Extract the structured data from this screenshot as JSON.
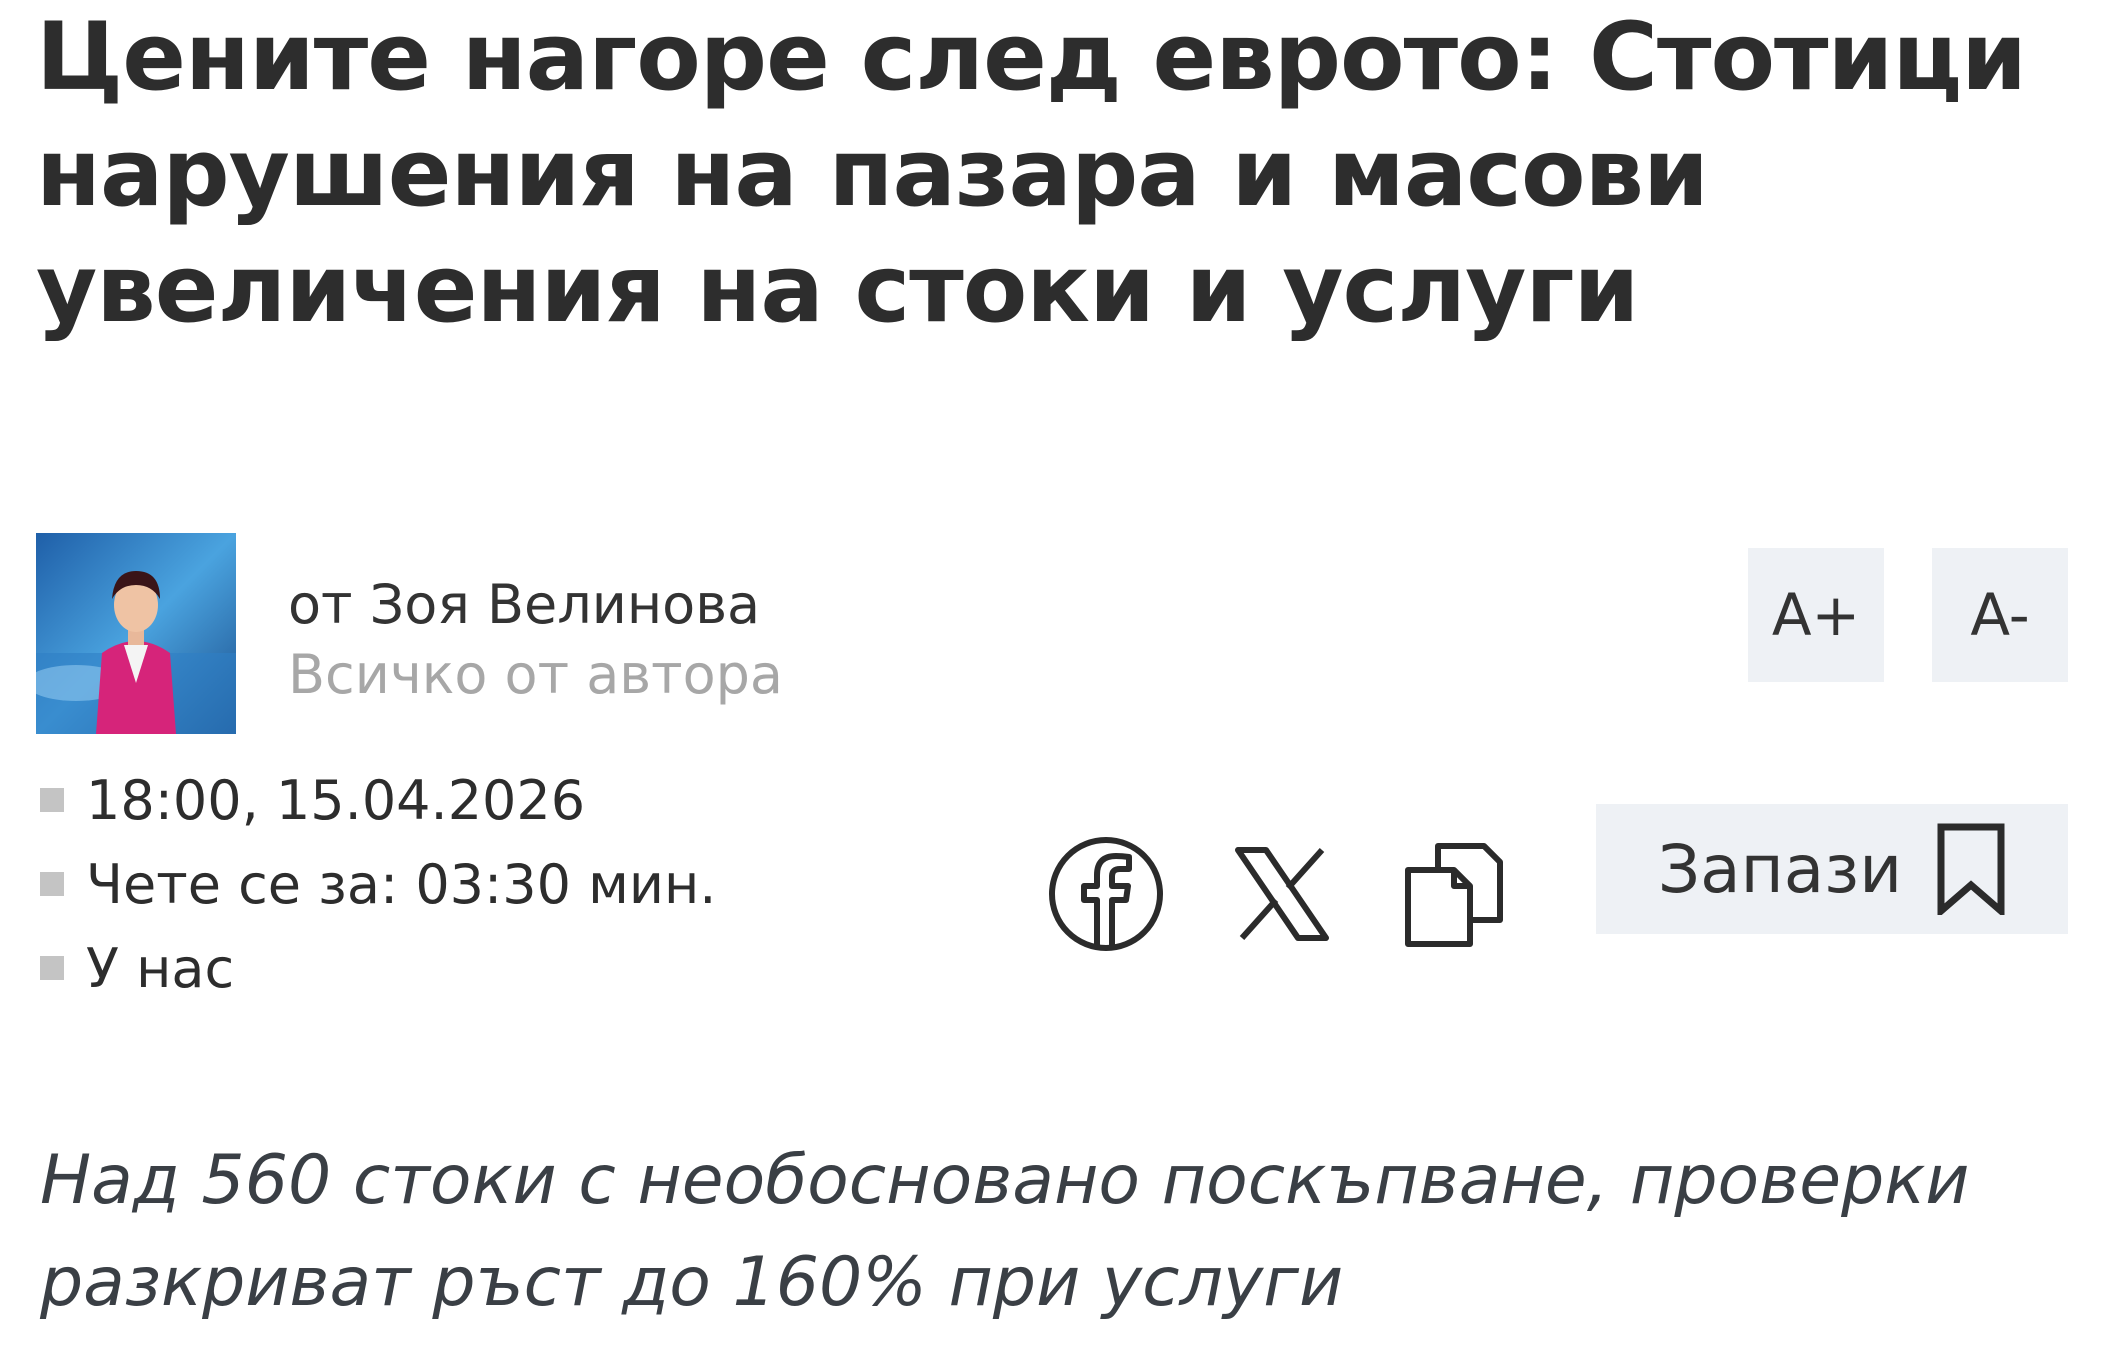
{
  "article": {
    "title": "Цените нагоре след еврото: Стотици нарушения на пазара и масови увеличения на стоки и услуги",
    "lead": "Над 560 стоки с необосновано поскъпване, проверки разкриват ръст до 160% при услуги"
  },
  "author": {
    "byline": "от Зоя Велинова",
    "all_link": "Всичко от автора"
  },
  "font_controls": {
    "increase_label": "A+",
    "decrease_label": "A-"
  },
  "meta": {
    "datetime": "18:00, 15.04.2026",
    "read_time": "Чете се за: 03:30 мин.",
    "category": "У нас"
  },
  "actions": {
    "save_label": "Запази"
  },
  "icons": {
    "share_facebook": "facebook-icon",
    "share_x": "x-icon",
    "copy_link": "copy-icon",
    "bookmark": "bookmark-icon"
  },
  "colors": {
    "button_bg": "#eef1f5",
    "text": "#2d2d2d",
    "muted": "#a7a7a7",
    "bullet": "#c4c4c4"
  }
}
